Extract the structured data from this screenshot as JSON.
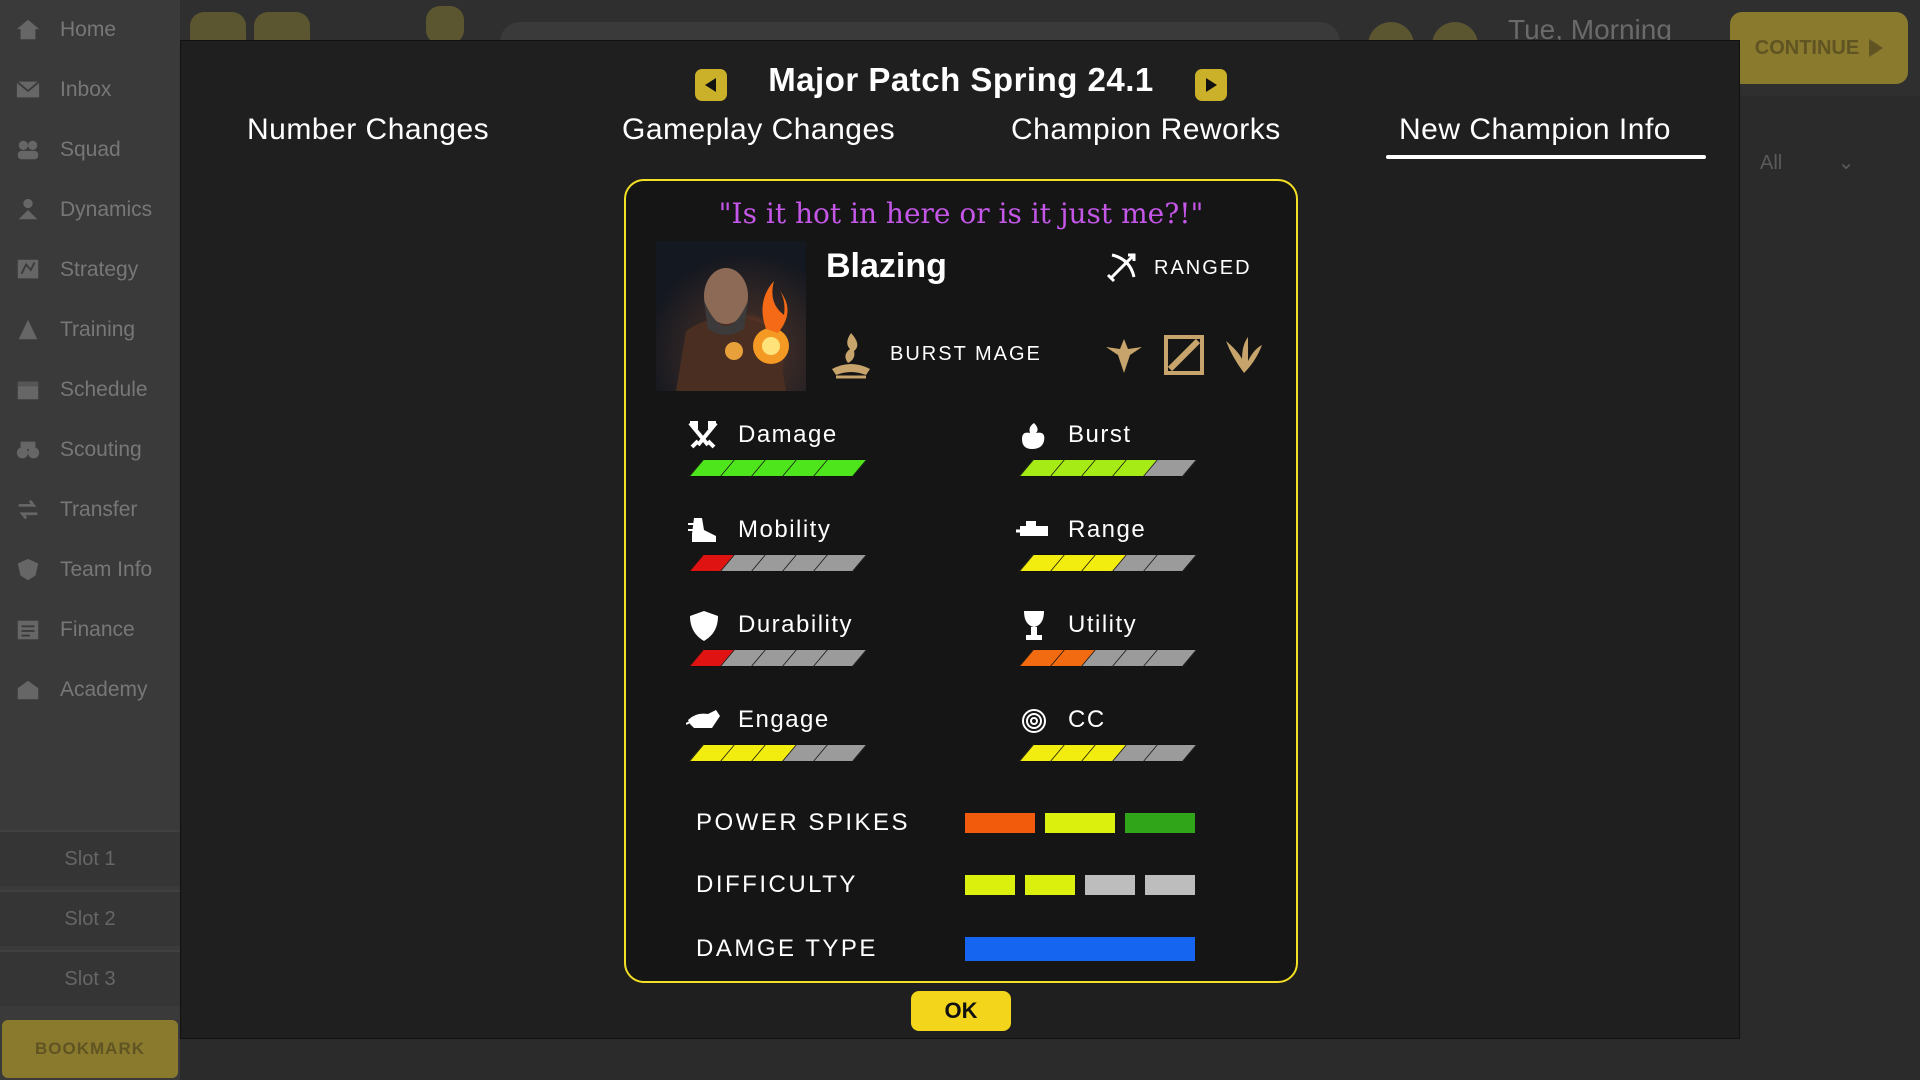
{
  "sidebar": {
    "items": [
      {
        "label": "Home",
        "icon": "home-icon"
      },
      {
        "label": "Inbox",
        "icon": "mail-icon"
      },
      {
        "label": "Squad",
        "icon": "people-icon"
      },
      {
        "label": "Dynamics",
        "icon": "dynamics-icon"
      },
      {
        "label": "Strategy",
        "icon": "strategy-icon"
      },
      {
        "label": "Training",
        "icon": "training-icon"
      },
      {
        "label": "Schedule",
        "icon": "calendar-icon"
      },
      {
        "label": "Scouting",
        "icon": "binoculars-icon"
      },
      {
        "label": "Transfer",
        "icon": "transfer-icon"
      },
      {
        "label": "Team Info",
        "icon": "crest-icon"
      },
      {
        "label": "Finance",
        "icon": "finance-icon"
      },
      {
        "label": "Academy",
        "icon": "academy-icon"
      }
    ],
    "slots": [
      "Slot 1",
      "Slot 2",
      "Slot 3"
    ],
    "bookmark_label": "BOOKMARK"
  },
  "topbar": {
    "datetime": "Tue, Morning",
    "continue_label": "CONTINUE",
    "filter_value": "All"
  },
  "modal": {
    "title": "Major Patch Spring 24.1",
    "tabs": [
      "Number Changes",
      "Gameplay Changes",
      "Champion Reworks",
      "New Champion Info"
    ],
    "active_tab": "New Champion Info",
    "ok_label": "OK"
  },
  "champion": {
    "quote": "\"Is it hot in here or is it just me?!\"",
    "name": "Blazing",
    "attack_type": "RANGED",
    "class": "BURST MAGE",
    "roles": [
      "support-role-icon",
      "mid-role-icon",
      "jungle-role-icon"
    ],
    "stats": [
      {
        "name": "Damage",
        "icon": "crossed-swords-icon",
        "value": 5,
        "max": 5,
        "color": "#4fe51c"
      },
      {
        "name": "Burst",
        "icon": "burst-icon",
        "value": 4,
        "max": 5,
        "color": "#a6ea16"
      },
      {
        "name": "Mobility",
        "icon": "boot-icon",
        "value": 1,
        "max": 5,
        "color": "#e01313"
      },
      {
        "name": "Range",
        "icon": "range-icon",
        "value": 3,
        "max": 5,
        "color": "#f3ed0f"
      },
      {
        "name": "Durability",
        "icon": "shield-icon",
        "value": 1,
        "max": 5,
        "color": "#e01313"
      },
      {
        "name": "Utility",
        "icon": "chalice-icon",
        "value": 2,
        "max": 5,
        "color": "#f26b10"
      },
      {
        "name": "Engage",
        "icon": "bull-icon",
        "value": 3,
        "max": 5,
        "color": "#f3ed0f"
      },
      {
        "name": "CC",
        "icon": "spiral-icon",
        "value": 3,
        "max": 5,
        "color": "#f3ed0f"
      }
    ],
    "power_spikes": {
      "label": "POWER SPIKES",
      "colors": [
        "#f25a0c",
        "#dcf00e",
        "#31a51a"
      ]
    },
    "difficulty": {
      "label": "DIFFICULTY",
      "value": 2,
      "max": 4,
      "color": "#dcf00e",
      "empty_color": "#bdbdbd"
    },
    "damage_type": {
      "label": "DAMGE TYPE",
      "color": "#1565f0"
    }
  }
}
